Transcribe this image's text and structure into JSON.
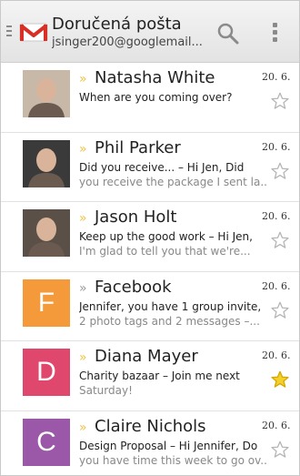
{
  "header": {
    "title": "Doručená pošta",
    "account": "jsinger200@googlemail..."
  },
  "colors": {
    "accent_star": "#f5cf2a",
    "importance_marker": "#f0c24a"
  },
  "messages": [
    {
      "sender": "Natasha White",
      "line1": "When are you coming over?",
      "line2": "",
      "date": "20. 6.",
      "starred": false,
      "important": true,
      "avatar": {
        "type": "photo",
        "icon": "user-photo",
        "letter": "",
        "color": "#c8b8a8"
      }
    },
    {
      "sender": "Phil Parker",
      "line1": "Did you receive... – Hi Jen, Did",
      "line2": "you receive the package I sent la...",
      "date": "20. 6.",
      "starred": false,
      "important": true,
      "avatar": {
        "type": "photo",
        "icon": "user-photo",
        "letter": "",
        "color": "#3a3a3a"
      }
    },
    {
      "sender": "Jason Holt",
      "line1": "Keep up the good work – Hi Jen,",
      "line2": "I'm glad to tell you that we're...",
      "date": "20. 6.",
      "starred": false,
      "important": true,
      "avatar": {
        "type": "photo",
        "icon": "user-photo",
        "letter": "",
        "color": "#5a5048"
      }
    },
    {
      "sender": "Facebook",
      "line1": "Jennifer, you have 1 group invite,",
      "line2": "2 photo tags and 2 messages –...",
      "date": "20. 6.",
      "starred": false,
      "important": false,
      "avatar": {
        "type": "letter",
        "icon": "",
        "letter": "F",
        "color": "#f49a3b"
      }
    },
    {
      "sender": "Diana Mayer",
      "line1": "Charity bazaar – Join me next",
      "line2": "Saturday!",
      "date": "20. 6.",
      "starred": true,
      "important": true,
      "avatar": {
        "type": "letter",
        "icon": "",
        "letter": "D",
        "color": "#e0476c"
      }
    },
    {
      "sender": "Claire Nichols",
      "line1": "Design Proposal – Hi Jennifer, Do",
      "line2": "you have time this week to go ov...",
      "date": "20. 6.",
      "starred": false,
      "important": true,
      "avatar": {
        "type": "letter",
        "icon": "",
        "letter": "C",
        "color": "#9b57a8"
      }
    }
  ]
}
